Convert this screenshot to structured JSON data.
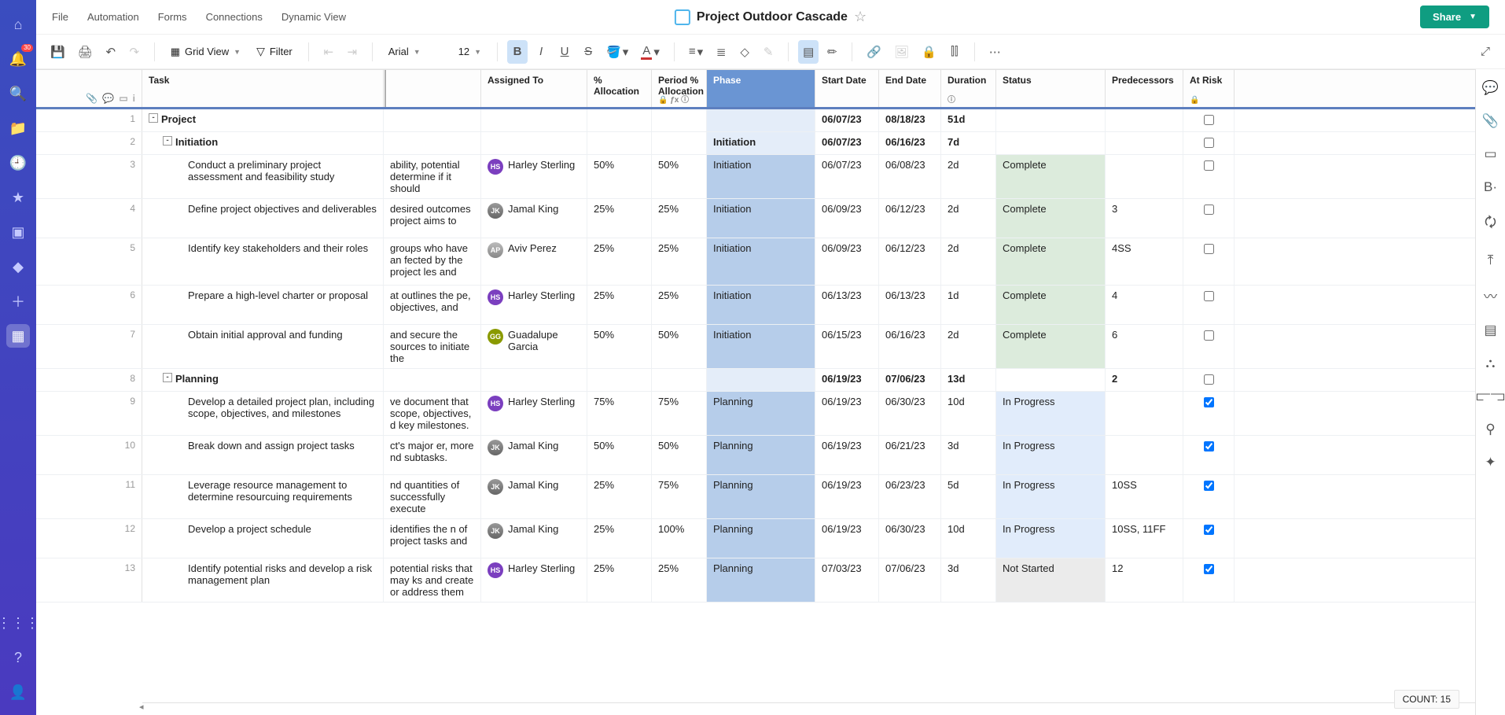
{
  "menu": {
    "items": [
      "File",
      "Automation",
      "Forms",
      "Connections",
      "Dynamic View"
    ],
    "title": "Project Outdoor Cascade",
    "share": "Share"
  },
  "toolbar": {
    "view": "Grid View",
    "filter": "Filter",
    "font": "Arial",
    "fontsize": "12"
  },
  "rail_badge": "30",
  "status_text": "COUNT: 15",
  "columns": {
    "task": "Task",
    "assigned": "Assigned To",
    "alloc": "% Allocation",
    "period": "Period % Allocation",
    "phase": "Phase",
    "start": "Start Date",
    "end": "End Date",
    "dur": "Duration",
    "status": "Status",
    "pred": "Predecessors",
    "risk": "At Risk"
  },
  "assignees": {
    "hs": {
      "name": "Harley Sterling",
      "initials": "HS",
      "cls": "av-hs"
    },
    "jk": {
      "name": "Jamal King",
      "initials": "JK",
      "cls": "av-jk"
    },
    "ap": {
      "name": "Aviv Perez",
      "initials": "AP",
      "cls": "av-ap"
    },
    "gg": {
      "name": "Guadalupe Garcia",
      "initials": "GG",
      "cls": "av-gg"
    }
  },
  "rows": [
    {
      "num": 1,
      "bold": true,
      "height": "",
      "indent": 0,
      "collapse": "-",
      "task": "Project",
      "extra": "",
      "assigned": "",
      "alloc": "",
      "period": "",
      "phase": "",
      "start": "06/07/23",
      "end": "08/18/23",
      "dur": "51d",
      "status": "",
      "statuscls": "",
      "pred": "",
      "risk": false
    },
    {
      "num": 2,
      "bold": true,
      "height": "",
      "indent": 1,
      "collapse": "-",
      "task": "Initiation",
      "extra": "",
      "assigned": "",
      "alloc": "",
      "period": "",
      "phase": "Initiation",
      "start": "06/07/23",
      "end": "06/16/23",
      "dur": "7d",
      "status": "",
      "statuscls": "",
      "pred": "",
      "risk": false
    },
    {
      "num": 3,
      "bold": false,
      "height": "h50",
      "indent": 2,
      "task": "Conduct a preliminary project assessment and feasibility study",
      "extra": "ability, potential determine if it should",
      "assigned": "hs",
      "alloc": "50%",
      "period": "50%",
      "phase": "Initiation",
      "start": "06/07/23",
      "end": "06/08/23",
      "dur": "2d",
      "status": "Complete",
      "statuscls": "complete",
      "pred": "",
      "risk": false
    },
    {
      "num": 4,
      "bold": false,
      "height": "h50",
      "indent": 2,
      "task": "Define project objectives and deliverables",
      "extra": "desired outcomes project aims to",
      "assigned": "jk",
      "alloc": "25%",
      "period": "25%",
      "phase": "Initiation",
      "start": "06/09/23",
      "end": "06/12/23",
      "dur": "2d",
      "status": "Complete",
      "statuscls": "complete",
      "pred": "3",
      "risk": false
    },
    {
      "num": 5,
      "bold": false,
      "height": "h60",
      "indent": 2,
      "task": "Identify key stakeholders and their roles",
      "extra": "groups who have an fected by the project les and",
      "assigned": "ap",
      "alloc": "25%",
      "period": "25%",
      "phase": "Initiation",
      "start": "06/09/23",
      "end": "06/12/23",
      "dur": "2d",
      "status": "Complete",
      "statuscls": "complete",
      "pred": "4SS",
      "risk": false
    },
    {
      "num": 6,
      "bold": false,
      "height": "h50",
      "indent": 2,
      "task": "Prepare a high-level charter or proposal",
      "extra": "at outlines the pe, objectives, and",
      "assigned": "hs",
      "alloc": "25%",
      "period": "25%",
      "phase": "Initiation",
      "start": "06/13/23",
      "end": "06/13/23",
      "dur": "1d",
      "status": "Complete",
      "statuscls": "complete",
      "pred": "4",
      "risk": false
    },
    {
      "num": 7,
      "bold": false,
      "height": "h50",
      "indent": 2,
      "task": "Obtain initial approval and funding",
      "extra": "and secure the sources to initiate the",
      "assigned": "gg",
      "alloc": "50%",
      "period": "50%",
      "phase": "Initiation",
      "start": "06/15/23",
      "end": "06/16/23",
      "dur": "2d",
      "status": "Complete",
      "statuscls": "complete",
      "pred": "6",
      "risk": false
    },
    {
      "num": 8,
      "bold": true,
      "height": "",
      "indent": 1,
      "collapse": "-",
      "task": "Planning",
      "extra": "",
      "assigned": "",
      "alloc": "",
      "period": "",
      "phase": "",
      "start": "06/19/23",
      "end": "07/06/23",
      "dur": "13d",
      "status": "",
      "statuscls": "",
      "pred": "2",
      "risk": false
    },
    {
      "num": 9,
      "bold": false,
      "height": "h50",
      "indent": 2,
      "task": "Develop a detailed project plan, including scope, objectives, and milestones",
      "extra": "ve document that scope, objectives, d key milestones.",
      "assigned": "hs",
      "alloc": "75%",
      "period": "75%",
      "phase": "Planning",
      "start": "06/19/23",
      "end": "06/30/23",
      "dur": "10d",
      "status": "In Progress",
      "statuscls": "inprogress",
      "pred": "",
      "risk": true
    },
    {
      "num": 10,
      "bold": false,
      "height": "h50",
      "indent": 2,
      "task": "Break down and assign project tasks",
      "extra": "ct's major er, more nd subtasks.",
      "assigned": "jk",
      "alloc": "50%",
      "period": "50%",
      "phase": "Planning",
      "start": "06/19/23",
      "end": "06/21/23",
      "dur": "3d",
      "status": "In Progress",
      "statuscls": "inprogress",
      "pred": "",
      "risk": true
    },
    {
      "num": 11,
      "bold": false,
      "height": "h50",
      "indent": 2,
      "task": "Leverage resource management to determine resourcuing requirements",
      "extra": "nd quantities of successfully execute",
      "assigned": "jk",
      "alloc": "25%",
      "period": "75%",
      "phase": "Planning",
      "start": "06/19/23",
      "end": "06/23/23",
      "dur": "5d",
      "status": "In Progress",
      "statuscls": "inprogress",
      "pred": "10SS",
      "risk": true
    },
    {
      "num": 12,
      "bold": false,
      "height": "h50",
      "indent": 2,
      "task": "Develop a project schedule",
      "extra": "identifies the n of project tasks and",
      "assigned": "jk",
      "alloc": "25%",
      "period": "100%",
      "phase": "Planning",
      "start": "06/19/23",
      "end": "06/30/23",
      "dur": "10d",
      "status": "In Progress",
      "statuscls": "inprogress",
      "pred": "10SS, 11FF",
      "risk": true
    },
    {
      "num": 13,
      "bold": false,
      "height": "h50",
      "indent": 2,
      "task": "Identify potential risks and develop a risk management plan",
      "extra": "potential risks that may ks and create or address them",
      "assigned": "hs",
      "alloc": "25%",
      "period": "25%",
      "phase": "Planning",
      "start": "07/03/23",
      "end": "07/06/23",
      "dur": "3d",
      "status": "Not Started",
      "statuscls": "notstarted",
      "pred": "12",
      "risk": true
    }
  ]
}
